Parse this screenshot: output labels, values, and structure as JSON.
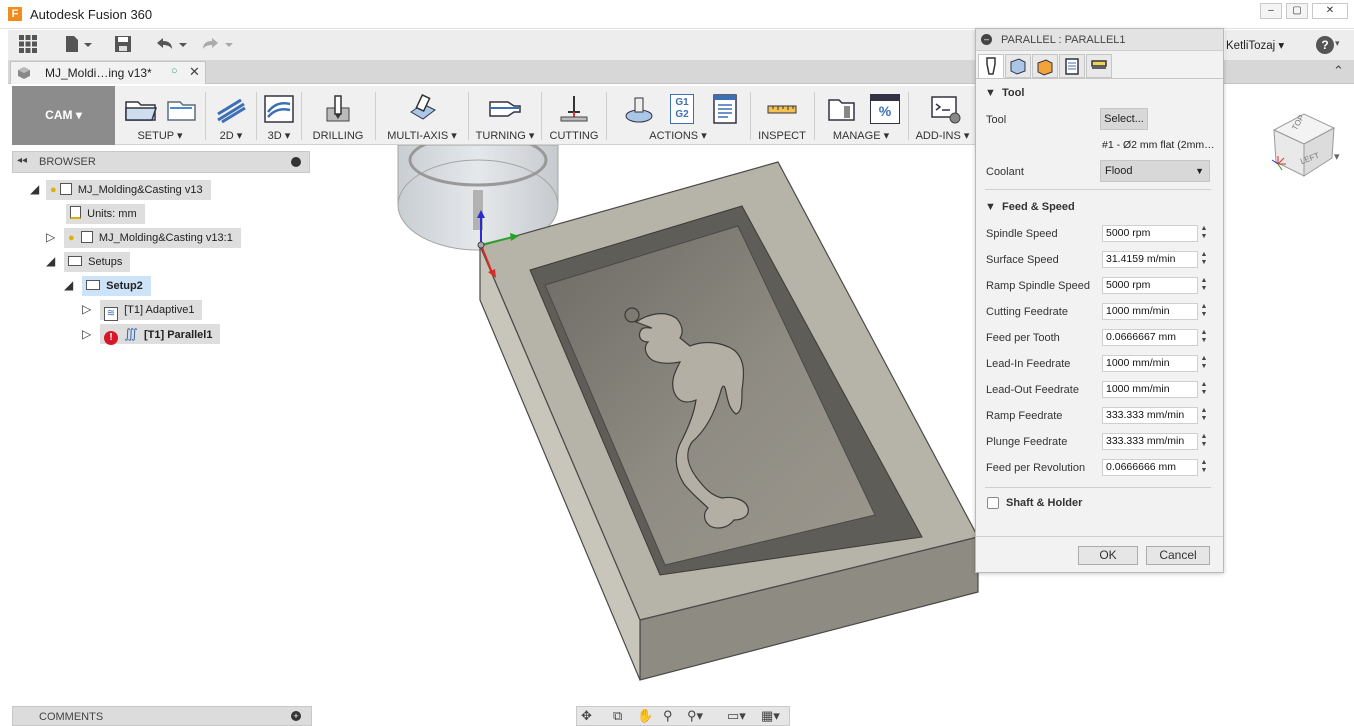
{
  "window": {
    "title": "Autodesk Fusion 360",
    "logo": "F",
    "controls": [
      "–",
      "▢",
      "✕"
    ]
  },
  "qat": {
    "user": "KetliTozaj",
    "help": "?"
  },
  "doc_tab": {
    "label": "MJ_Moldi…ing v13*"
  },
  "ribbon": {
    "workspace": "CAM",
    "groups": [
      {
        "label": "SETUP ▾"
      },
      {
        "label": "2D ▾"
      },
      {
        "label": "3D ▾"
      },
      {
        "label": "DRILLING"
      },
      {
        "label": "MULTI-AXIS ▾"
      },
      {
        "label": "TURNING ▾"
      },
      {
        "label": "CUTTING"
      },
      {
        "label": "ACTIONS ▾"
      },
      {
        "label": "INSPECT"
      },
      {
        "label": "MANAGE ▾"
      },
      {
        "label": "ADD-INS ▾"
      }
    ],
    "actions_g1g2": "G1\nG2",
    "manage_percent": "%"
  },
  "browser": {
    "title": "BROWSER",
    "items": [
      {
        "label": "MJ_Molding&Casting v13"
      },
      {
        "label": "Units: mm"
      },
      {
        "label": "MJ_Molding&Casting v13:1"
      },
      {
        "label": "Setups"
      },
      {
        "label": "Setup2"
      },
      {
        "label": "[T1] Adaptive1"
      },
      {
        "label": "[T1] Parallel1"
      }
    ]
  },
  "comments": {
    "title": "COMMENTS"
  },
  "viewcube": {
    "top": "TOP",
    "left": "LEFT"
  },
  "dialog": {
    "title": "PARALLEL : PARALLEL1",
    "tool_section": "Tool",
    "tool_label": "Tool",
    "tool_select": "Select...",
    "tool_desc": "#1 - Ø2 mm flat (2mm…",
    "coolant_label": "Coolant",
    "coolant_value": "Flood",
    "feed_section": "Feed & Speed",
    "params": [
      {
        "label": "Spindle Speed",
        "value": "5000 rpm"
      },
      {
        "label": "Surface Speed",
        "value": "31.4159 m/min"
      },
      {
        "label": "Ramp Spindle Speed",
        "value": "5000 rpm"
      },
      {
        "label": "Cutting Feedrate",
        "value": "1000 mm/min"
      },
      {
        "label": "Feed per Tooth",
        "value": "0.0666667 mm"
      },
      {
        "label": "Lead-In Feedrate",
        "value": "1000 mm/min"
      },
      {
        "label": "Lead-Out Feedrate",
        "value": "1000 mm/min"
      },
      {
        "label": "Ramp Feedrate",
        "value": "333.333 mm/min"
      },
      {
        "label": "Plunge Feedrate",
        "value": "333.333 mm/min"
      },
      {
        "label": "Feed per Revolution",
        "value": "0.0666666 mm"
      }
    ],
    "shaft_section": "Shaft & Holder",
    "ok": "OK",
    "cancel": "Cancel"
  }
}
